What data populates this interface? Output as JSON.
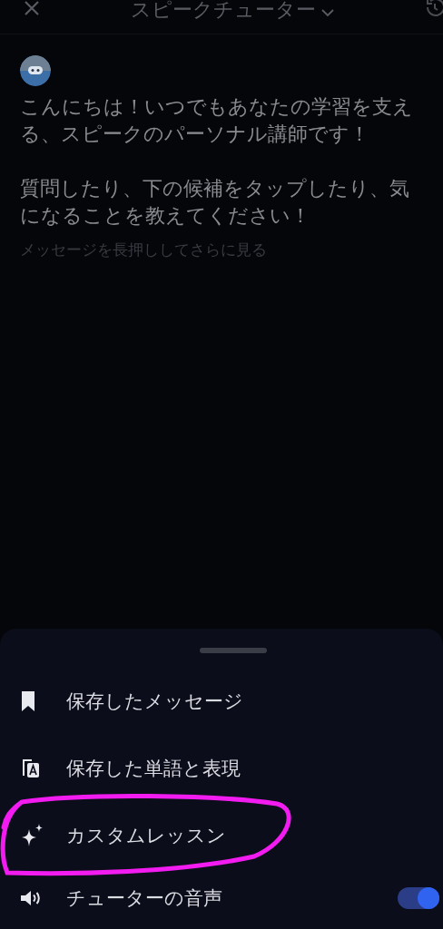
{
  "header": {
    "title": "スピークチューター"
  },
  "message": {
    "paragraphs": [
      "こんにちは！いつでもあなたの学習を支える、スピークのパーソナル講師です！",
      "質問したり、下の候補をタップしたり、気になることを教えてください！"
    ],
    "hint": "メッセージを長押ししてさらに見る"
  },
  "menu": {
    "items": [
      {
        "kind": "link",
        "label": "保存したメッセージ"
      },
      {
        "kind": "link",
        "label": "保存した単語と表現"
      },
      {
        "kind": "link",
        "label": "カスタムレッスン",
        "circled": true
      },
      {
        "kind": "toggle",
        "label": "チューターの音声",
        "on": true
      }
    ]
  }
}
